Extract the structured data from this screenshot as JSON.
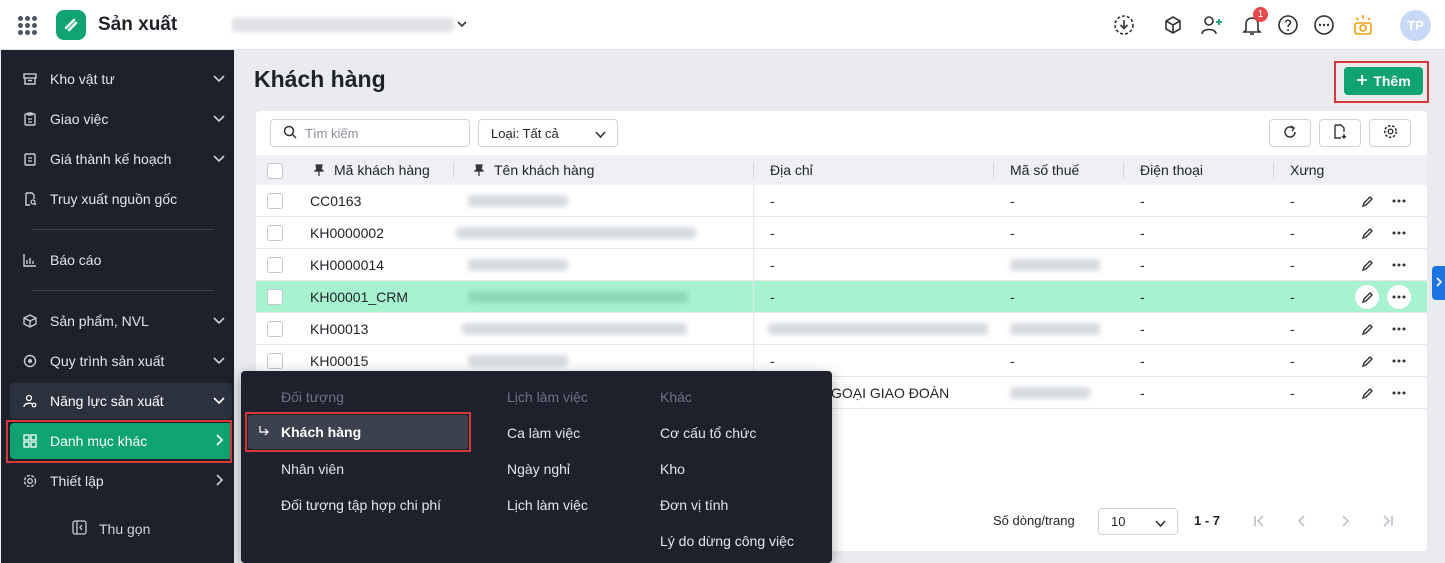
{
  "header": {
    "app_name": "Sản xuất",
    "avatar_initials": "TP",
    "notification_count": "1",
    "accent_color": "#0ea371"
  },
  "sidebar": {
    "items": [
      {
        "label": "Kho vật tư",
        "icon": "archive-icon",
        "has_children": true
      },
      {
        "label": "Giao việc",
        "icon": "clipboard-icon",
        "has_children": true
      },
      {
        "label": "Giá thành kế hoạch",
        "icon": "price-tag-icon",
        "has_children": true
      },
      {
        "label": "Truy xuất nguồn gốc",
        "icon": "doc-search-icon",
        "has_children": false
      },
      {
        "label": "Báo cáo",
        "icon": "bar-chart-icon",
        "has_children": false
      },
      {
        "label": "Sản phẩm, NVL",
        "icon": "cube-icon",
        "has_children": true
      },
      {
        "label": "Quy trình sản xuất",
        "icon": "cycle-icon",
        "has_children": true
      },
      {
        "label": "Năng lực sản xuất",
        "icon": "user-gear-icon",
        "has_children": true
      },
      {
        "label": "Danh mục khác",
        "icon": "grid-icon",
        "has_children": true,
        "active": true
      },
      {
        "label": "Thiết lập",
        "icon": "settings-icon",
        "has_children": true
      }
    ],
    "collapse_label": "Thu gọn"
  },
  "page": {
    "title": "Khách hàng",
    "add_button": "Thêm",
    "search_placeholder": "Tìm kiếm",
    "type_filter": "Loại: Tất cả"
  },
  "table": {
    "columns": [
      "Mã khách hàng",
      "Tên khách hàng",
      "Địa chỉ",
      "Mã số thuế",
      "Điện thoại",
      "Xưng"
    ],
    "rows": [
      {
        "code": "CC0163",
        "address": "-",
        "tax": "-",
        "phone": "-",
        "title": "-"
      },
      {
        "code": "KH0000002",
        "address": "-",
        "tax": "-",
        "phone": "-",
        "title": "-"
      },
      {
        "code": "KH0000014",
        "address": "-",
        "tax": "",
        "phone": "-",
        "title": "-"
      },
      {
        "code": "KH00001_CRM",
        "address": "-",
        "tax": "-",
        "phone": "-",
        "title": "-",
        "highlighted": true
      },
      {
        "code": "KH00013",
        "address": "",
        "tax": "",
        "phone": "-",
        "title": "-"
      },
      {
        "code": "KH00015",
        "address": "-",
        "tax": "-",
        "phone": "-",
        "title": "-"
      },
      {
        "code": "",
        "address": "GOẠI GIAO ĐOÀN",
        "tax": "",
        "phone": "-",
        "title": "-"
      }
    ]
  },
  "pagination": {
    "rows_per_page_label": "Số dòng/trang",
    "rows_per_page": "10",
    "range": "1 - 7"
  },
  "flyout": {
    "columns": [
      {
        "heading": "Đối tượng",
        "items": [
          "Khách hàng",
          "Nhân viên",
          "Đối tượng tập hợp chi phí"
        ]
      },
      {
        "heading": "Lịch làm việc",
        "items": [
          "Ca làm việc",
          "Ngày nghỉ",
          "Lịch làm việc"
        ]
      },
      {
        "heading": "Khác",
        "items": [
          "Cơ cấu tổ chức",
          "Kho",
          "Đơn vị tính",
          "Lý do dừng công việc"
        ]
      }
    ],
    "selected_item": "Khách hàng"
  }
}
